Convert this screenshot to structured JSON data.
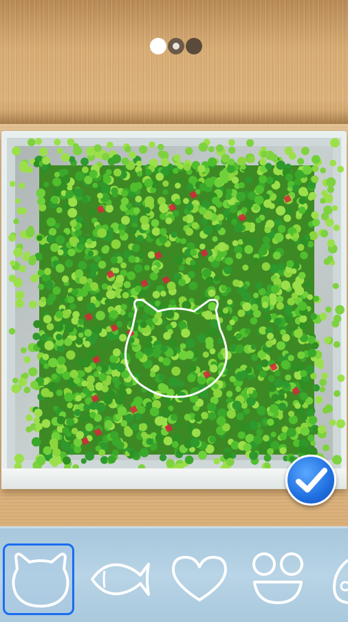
{
  "level_progress": {
    "stages": [
      "done",
      "current",
      "pending"
    ]
  },
  "game": {
    "target_shape": "cat-head",
    "confirm_icon": "checkmark-icon",
    "colors": {
      "grass_light": "#9be04a",
      "grass_mid": "#4fbf2e",
      "grass_dark": "#2f8f23",
      "flower_red": "#d8243a",
      "confirm_blue": "#1f6fe0",
      "selection_border": "#1a6cf0"
    }
  },
  "shape_bar": {
    "items": [
      {
        "shape": "cat-head",
        "icon": "cat-head-icon",
        "selected": true
      },
      {
        "shape": "fish",
        "icon": "fish-icon",
        "selected": false
      },
      {
        "shape": "heart",
        "icon": "heart-icon",
        "selected": false
      },
      {
        "shape": "smiley-face",
        "icon": "smiley-face-icon",
        "selected": false
      },
      {
        "shape": "partial",
        "icon": "partial-shape-icon",
        "selected": false
      }
    ]
  }
}
